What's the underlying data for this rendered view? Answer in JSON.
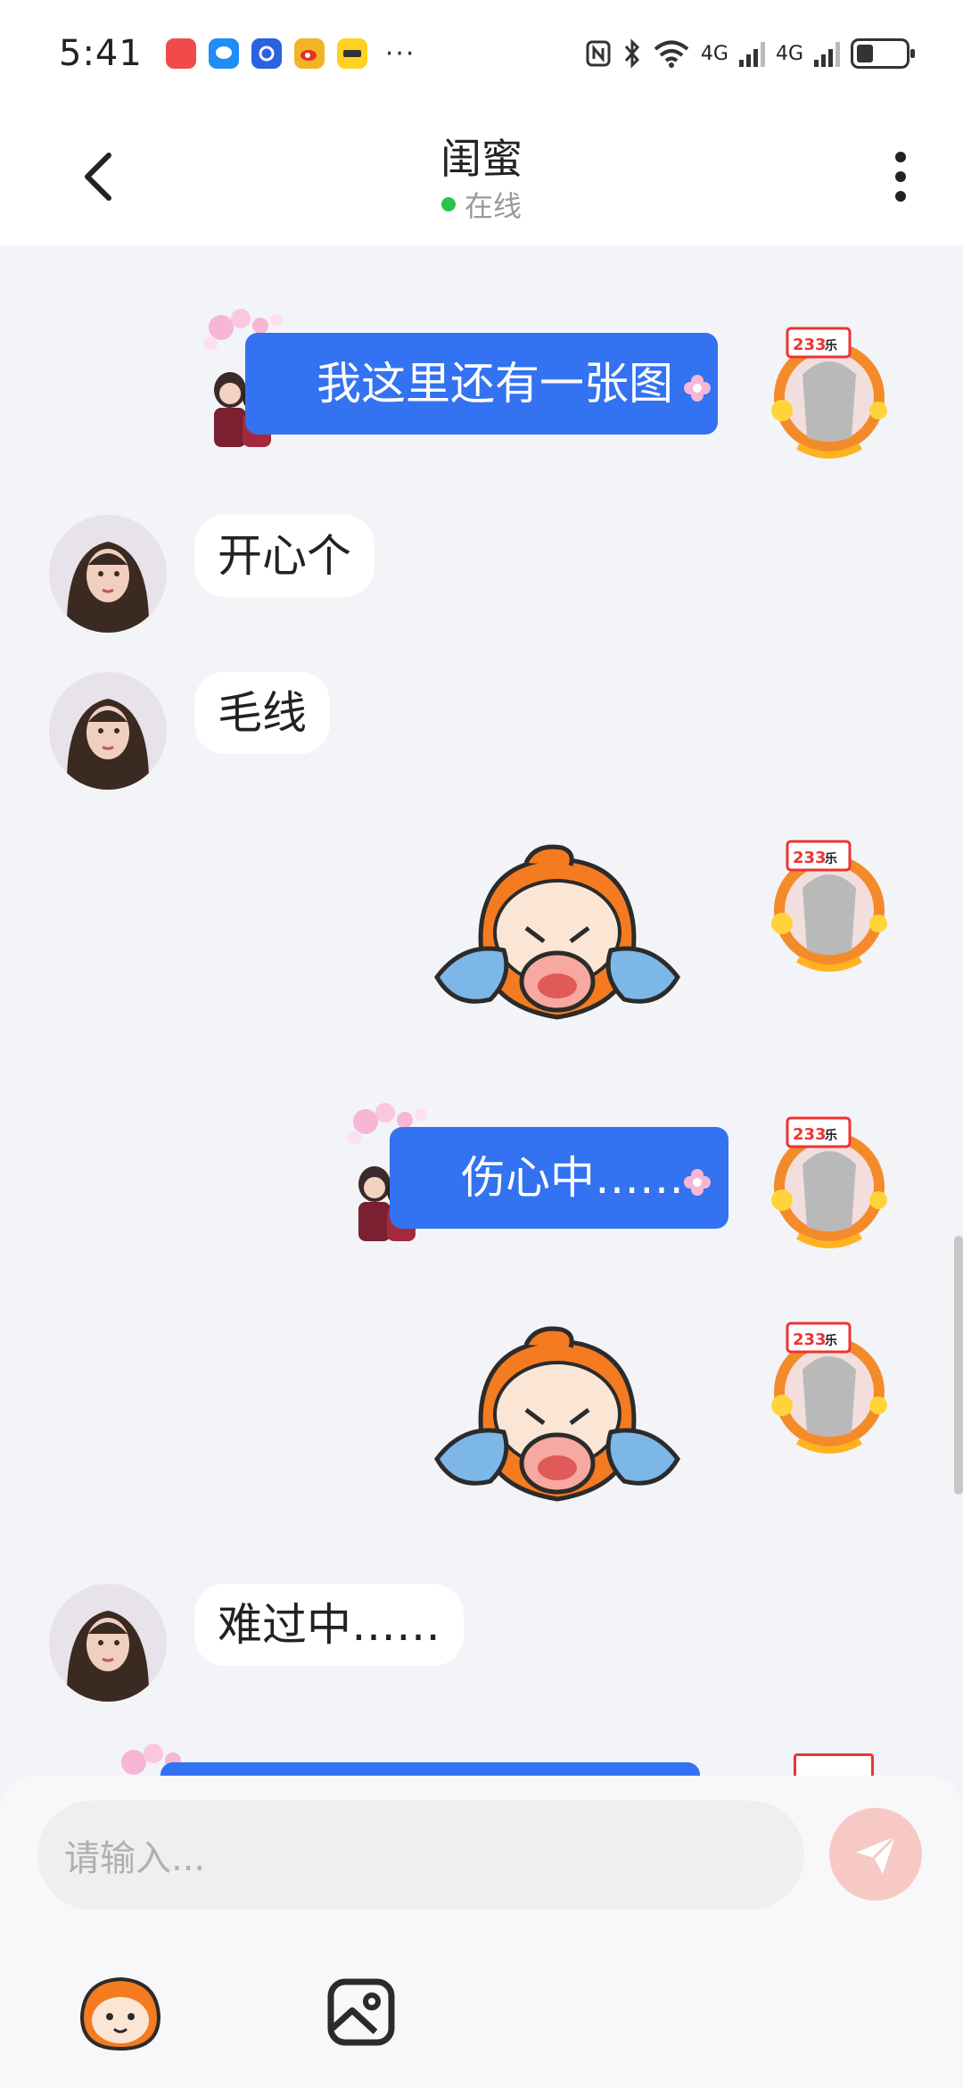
{
  "status_bar": {
    "time": "5:41",
    "more": "···",
    "net1": "4G",
    "net2": "4G",
    "apps": [
      {
        "name": "app-icon-red",
        "color": "#f04a4a"
      },
      {
        "name": "messages-icon",
        "color": "#1e8df5"
      },
      {
        "name": "app-icon-blue",
        "color": "#2a62e0"
      },
      {
        "name": "weibo-icon",
        "color": "#f2b423"
      },
      {
        "name": "meituan-icon",
        "color": "#ffd21f"
      }
    ]
  },
  "header": {
    "title": "闺蜜",
    "status": "在线"
  },
  "messages": [
    {
      "side": "right",
      "type": "text",
      "text": "我这里还有一张图"
    },
    {
      "side": "left",
      "type": "text",
      "text": "开心个"
    },
    {
      "side": "left",
      "type": "text",
      "text": "毛线"
    },
    {
      "side": "right",
      "type": "sticker",
      "sticker": "crying-cat-sticker"
    },
    {
      "side": "right",
      "type": "text",
      "text": "伤心中……"
    },
    {
      "side": "right",
      "type": "sticker",
      "sticker": "crying-cat-sticker"
    },
    {
      "side": "left",
      "type": "text",
      "text": "难过中……"
    }
  ],
  "input": {
    "placeholder": "请输入..."
  },
  "colors": {
    "bubble_self": "#3372f0",
    "bubble_other": "#ffffff",
    "online": "#2bc34a",
    "send": "#f7c9c5"
  }
}
